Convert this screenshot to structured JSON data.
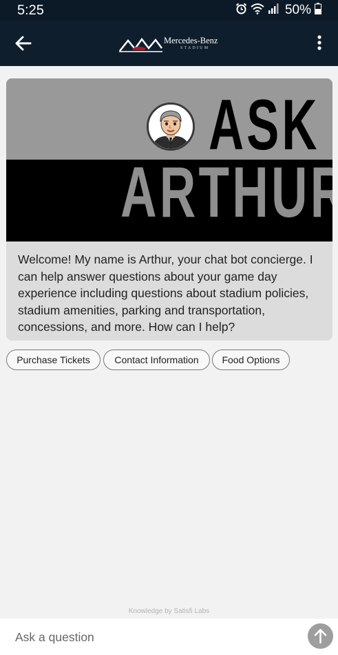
{
  "status_bar": {
    "time": "5:25",
    "battery": "50%"
  },
  "app_bar": {
    "brand": "Mercedes-Benz",
    "brand_sub": "STADIUM"
  },
  "banner": {
    "line1": "ASK",
    "line2": "ARTHUR"
  },
  "welcome": {
    "message": "Welcome! My name is Arthur, your chat bot concierge. I can help answer questions about your game day experience including questions about stadium policies, stadium amenities, parking and transportation, concessions, and more. How can I help?"
  },
  "chips": [
    {
      "label": "Purchase Tickets"
    },
    {
      "label": "Contact Information"
    },
    {
      "label": "Food Options"
    }
  ],
  "footer": {
    "credit": "Knowledge by Satisfi Labs"
  },
  "input": {
    "placeholder": "Ask a question"
  },
  "icons": {
    "back": "arrow-left-icon",
    "menu": "more-vertical-icon",
    "send": "arrow-up-icon",
    "alarm": "alarm-clock-icon",
    "wifi": "wifi-icon",
    "signal": "signal-icon",
    "battery": "battery-icon"
  },
  "colors": {
    "app_bar": "#0f1e2d",
    "status_bar": "#0c1a28",
    "banner_gray": "#999999",
    "banner_black": "#000000",
    "send_button": "#9e9e9e"
  }
}
